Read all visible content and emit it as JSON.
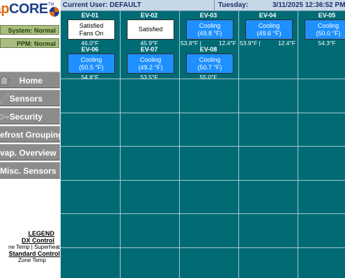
{
  "logo": {
    "part1": "vap",
    "part2": "CORE",
    "tm": "TM"
  },
  "status": {
    "system": "System: Normal",
    "ppm": "PPM: Normal"
  },
  "nav": {
    "home": "Home",
    "sensors": "Sensors",
    "security": "Security",
    "defrost": "efrost Grouping",
    "evap": "vap. Overview",
    "misc": "Misc. Sensors"
  },
  "legend": {
    "title": "LEGEND",
    "dx_title": "DX Control",
    "dx_desc": "ne Temp | Superheat",
    "std_title": "Standard Control",
    "std_desc": "Zone Temp"
  },
  "header": {
    "user": "Current User: DEFAULT",
    "day": "Tuesday:",
    "datetime": "3/11/2025 12:36:52 PM"
  },
  "evaporators": [
    {
      "id": "EV-01",
      "state": "satisfied",
      "line1": "Satisfied",
      "line2": "Fans On",
      "temp_left": "46.0°F",
      "temp_right": ""
    },
    {
      "id": "EV-02",
      "state": "satisfied",
      "line1": "Satisfied",
      "line2": "",
      "temp_left": "45.9°F",
      "temp_right": ""
    },
    {
      "id": "EV-03",
      "state": "cooling",
      "line1": "Cooling",
      "line2": "(49.8 °F)",
      "temp_left": "53.8°F |",
      "temp_right": "12.4°F"
    },
    {
      "id": "EV-04",
      "state": "cooling",
      "line1": "Cooling",
      "line2": "(49.6 °F)",
      "temp_left": "53.9°F |",
      "temp_right": "12.4°F"
    },
    {
      "id": "EV-05",
      "state": "cooling",
      "line1": "Cooling",
      "line2": "(50.0 °F)",
      "temp_left": "54.3°F",
      "temp_right": ""
    },
    {
      "id": "EV-06",
      "state": "cooling",
      "line1": "Cooling",
      "line2": "(50.5 °F)",
      "temp_left": "54.8°F",
      "temp_right": ""
    },
    {
      "id": "EV-07",
      "state": "cooling",
      "line1": "Cooling",
      "line2": "(49.2 °F)",
      "temp_left": "53.5°F",
      "temp_right": ""
    },
    {
      "id": "EV-08",
      "state": "cooling",
      "line1": "Cooling",
      "line2": "(50.7 °F)",
      "temp_left": "55.0°F",
      "temp_right": ""
    }
  ],
  "colors": {
    "cooling": "#1e90ff",
    "satisfied": "#ffffff",
    "grid_bg": "#006b75",
    "status_ok": "#a8bd7e"
  }
}
